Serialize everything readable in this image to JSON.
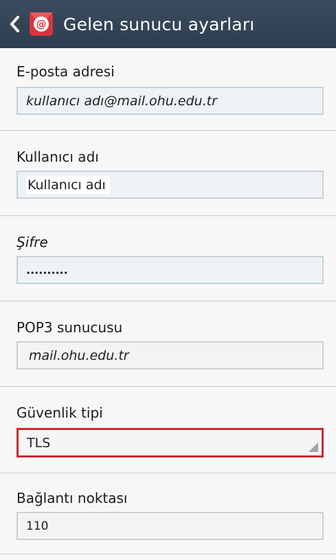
{
  "header": {
    "title": "Gelen sunucu ayarları",
    "back_icon": "chevron-left-icon",
    "app_icon": "email-at-icon",
    "colors": {
      "bar": "#33455a",
      "app_icon_bg": "#d9363e"
    }
  },
  "fields": {
    "email": {
      "label": "E-posta adresi",
      "value": "kullanıcı adı@mail.ohu.edu.tr"
    },
    "username": {
      "label": "Kullanıcı adı",
      "value": "Kullanıcı adı"
    },
    "password": {
      "label": "Şifre",
      "value": ".........."
    },
    "pop3": {
      "label": "POP3 sunucusu",
      "value": "mail.ohu.edu.tr"
    },
    "security": {
      "label": "Güvenlik tipi",
      "value": "TLS",
      "highlight_color": "#c82a32"
    },
    "port": {
      "label": "Bağlantı noktası",
      "value": "110"
    }
  }
}
